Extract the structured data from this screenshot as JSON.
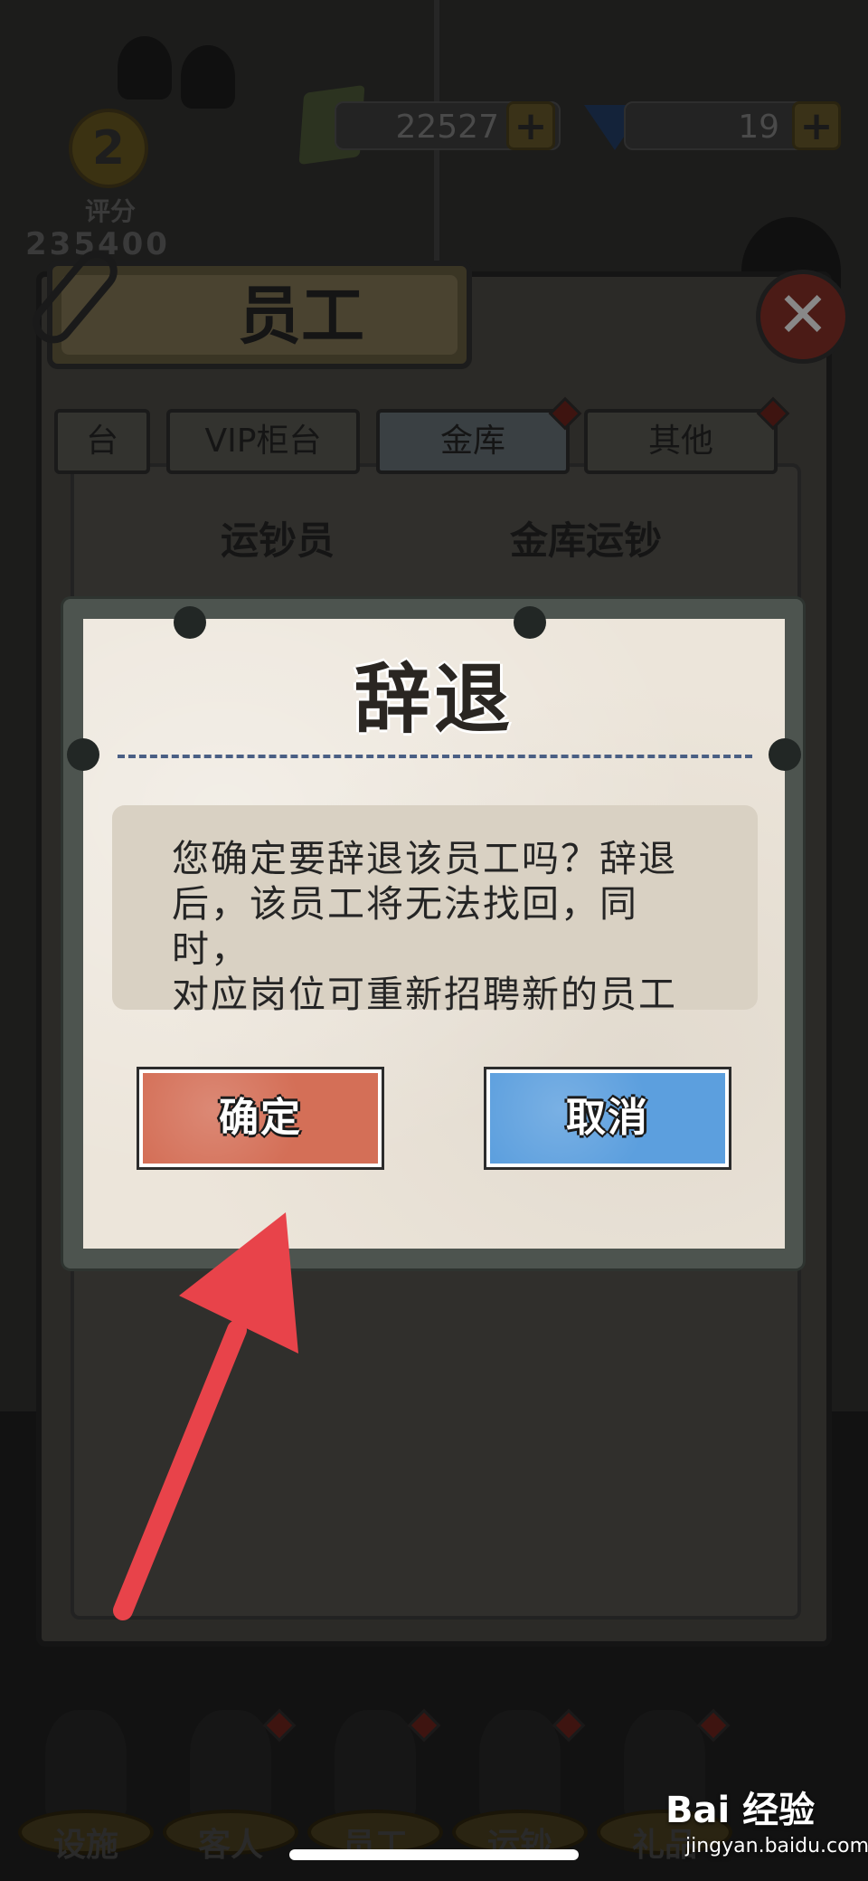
{
  "hud": {
    "cash_value": "22527",
    "gem_value": "19",
    "plus_label": "+",
    "score_number": "2",
    "score_label": "评分",
    "score_value": "235400"
  },
  "panel": {
    "title": "员工",
    "close_label": "✕",
    "tabs": [
      {
        "label": "台"
      },
      {
        "label": "VIP柜台"
      },
      {
        "label": "金库"
      },
      {
        "label": "其他"
      }
    ],
    "sub_headers": [
      "运钞员",
      "金库运钞"
    ]
  },
  "dialog": {
    "title": "辞退",
    "message_lines": [
      "您确定要辞退该员工吗？辞退",
      "后，该员工将无法找回，同时，",
      "对应岗位可重新招聘新的员工"
    ],
    "confirm_label": "确定",
    "cancel_label": "取消"
  },
  "bottom_nav": [
    {
      "label": "设施"
    },
    {
      "label": "客人"
    },
    {
      "label": "员工"
    },
    {
      "label": "运钞"
    },
    {
      "label": "礼品"
    }
  ],
  "watermark": {
    "brand": "Bai 经验",
    "url": "jingyan.baidu.com"
  },
  "colors": {
    "confirm": "#d46f57",
    "cancel": "#5c9fde",
    "divider": "#4a5f84",
    "arrow": "#e8434a"
  }
}
